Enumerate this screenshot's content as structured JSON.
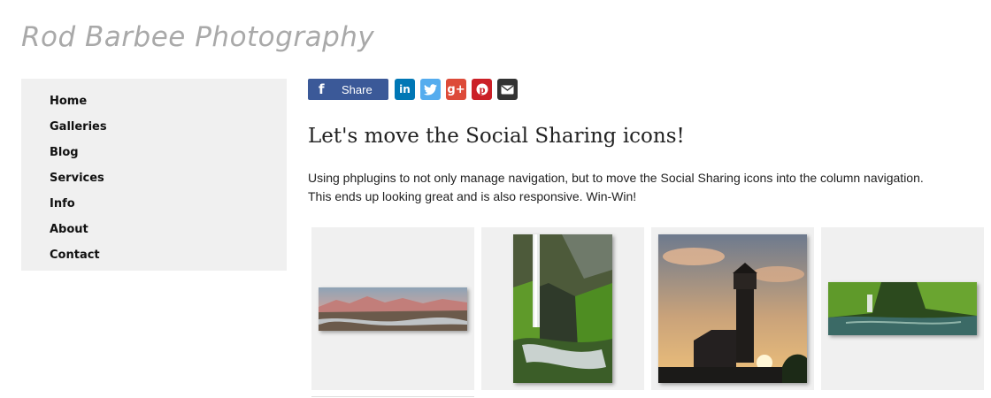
{
  "site": {
    "title": "Rod Barbee Photography"
  },
  "nav": {
    "items": [
      {
        "label": "Home"
      },
      {
        "label": "Galleries"
      },
      {
        "label": "Blog"
      },
      {
        "label": "Services"
      },
      {
        "label": "Info"
      },
      {
        "label": "About"
      },
      {
        "label": "Contact"
      }
    ]
  },
  "share": {
    "button_label": "Share",
    "icons": [
      "facebook-icon",
      "linkedin-icon",
      "twitter-icon",
      "google-plus-icon",
      "pinterest-icon",
      "email-icon"
    ],
    "colors": {
      "facebook": "#3b5998",
      "linkedin": "#0077b5",
      "twitter": "#55acee",
      "google_plus": "#dd4b39",
      "pinterest": "#cb2027",
      "email": "#333333"
    }
  },
  "post": {
    "heading": "Let's move the Social Sharing icons!",
    "body_line1": "Using phplugins to not only manage navigation, but to move the Social Sharing icons into the column navigation.",
    "body_line2": "This ends up looking great and is also responsive. Win-Win!"
  },
  "gallery": {
    "thumbnails": [
      {
        "subject": "panorama-landscape"
      },
      {
        "subject": "waterfall"
      },
      {
        "subject": "lighthouse-sunset"
      },
      {
        "subject": "forest-creek"
      }
    ]
  }
}
